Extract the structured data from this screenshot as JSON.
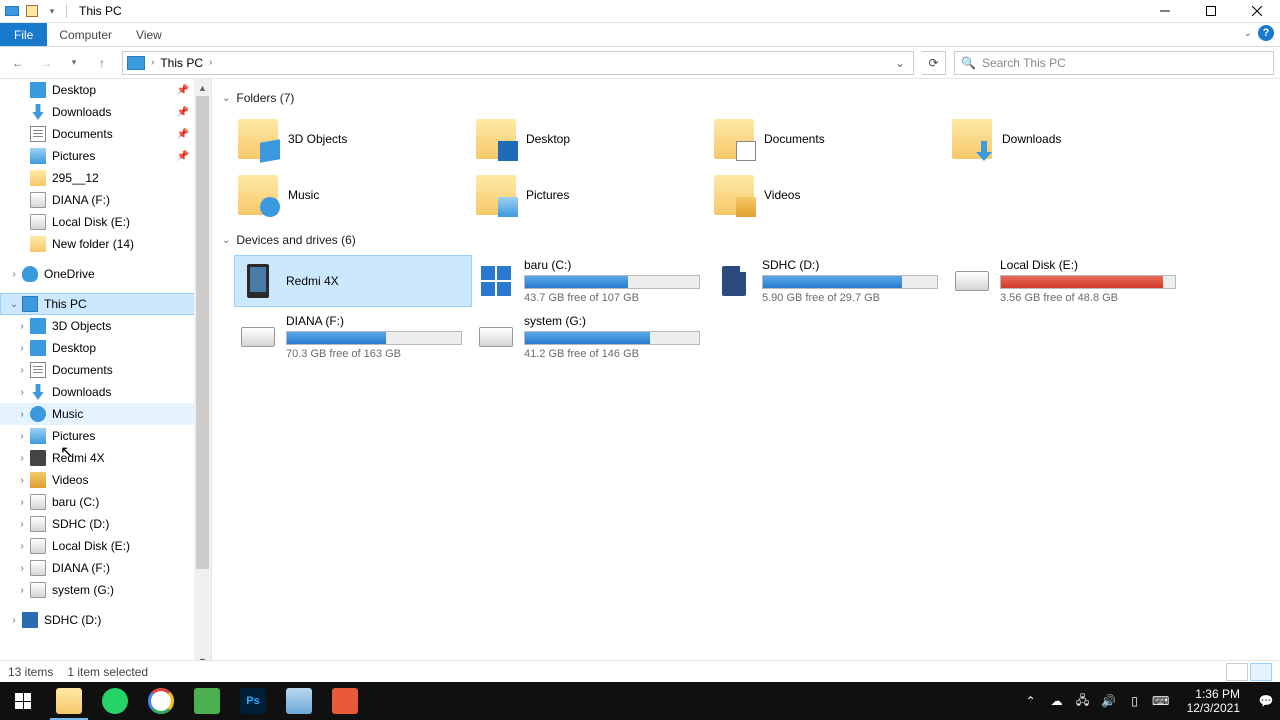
{
  "window": {
    "title": "This PC"
  },
  "ribbon": {
    "file": "File",
    "tabs": [
      "Computer",
      "View"
    ]
  },
  "address": {
    "crumbs": [
      "This PC"
    ]
  },
  "search": {
    "placeholder": "Search This PC"
  },
  "sidebar": {
    "quick": [
      {
        "label": "Desktop",
        "icon": "desktop",
        "pinned": true
      },
      {
        "label": "Downloads",
        "icon": "downloads",
        "pinned": true
      },
      {
        "label": "Documents",
        "icon": "docs",
        "pinned": true
      },
      {
        "label": "Pictures",
        "icon": "pics",
        "pinned": true
      },
      {
        "label": "295__12",
        "icon": "folder"
      },
      {
        "label": "DIANA (F:)",
        "icon": "drive"
      },
      {
        "label": "Local Disk (E:)",
        "icon": "drive"
      },
      {
        "label": "New folder (14)",
        "icon": "folder"
      }
    ],
    "onedrive": {
      "label": "OneDrive"
    },
    "thispc": {
      "label": "This PC",
      "children": [
        {
          "label": "3D Objects",
          "icon": "desktop"
        },
        {
          "label": "Desktop",
          "icon": "desktop"
        },
        {
          "label": "Documents",
          "icon": "docs"
        },
        {
          "label": "Downloads",
          "icon": "downloads"
        },
        {
          "label": "Music",
          "icon": "music",
          "hover": true
        },
        {
          "label": "Pictures",
          "icon": "pics"
        },
        {
          "label": "Redmi 4X",
          "icon": "phone"
        },
        {
          "label": "Videos",
          "icon": "video"
        },
        {
          "label": "baru (C:)",
          "icon": "drive"
        },
        {
          "label": "SDHC (D:)",
          "icon": "drive"
        },
        {
          "label": "Local Disk (E:)",
          "icon": "drive"
        },
        {
          "label": "DIANA (F:)",
          "icon": "drive"
        },
        {
          "label": "system (G:)",
          "icon": "drive"
        }
      ]
    },
    "sdhc": {
      "label": "SDHC (D:)"
    }
  },
  "groups": {
    "folders": {
      "title": "Folders (7)"
    },
    "drives": {
      "title": "Devices and drives (6)"
    }
  },
  "folders": [
    {
      "name": "3D Objects",
      "ov": "3d"
    },
    {
      "name": "Desktop",
      "ov": "desk"
    },
    {
      "name": "Documents",
      "ov": "doc"
    },
    {
      "name": "Downloads",
      "ov": "dl"
    },
    {
      "name": "Music",
      "ov": "music"
    },
    {
      "name": "Pictures",
      "ov": "pic"
    },
    {
      "name": "Videos",
      "ov": "vid"
    }
  ],
  "drives": [
    {
      "name": "Redmi 4X",
      "type": "phone",
      "selected": true
    },
    {
      "name": "baru (C:)",
      "type": "win",
      "free": "43.7 GB free of 107 GB",
      "pct": 59
    },
    {
      "name": "SDHC (D:)",
      "type": "sd",
      "free": "5.90 GB free of 29.7 GB",
      "pct": 80
    },
    {
      "name": "Local Disk (E:)",
      "type": "hdd",
      "free": "3.56 GB free of 48.8 GB",
      "pct": 93,
      "red": true
    },
    {
      "name": "DIANA (F:)",
      "type": "hdd",
      "free": "70.3 GB free of 163 GB",
      "pct": 57
    },
    {
      "name": "system (G:)",
      "type": "hdd",
      "free": "41.2 GB free of 146 GB",
      "pct": 72
    }
  ],
  "status": {
    "items": "13 items",
    "selected": "1 item selected"
  },
  "taskbar": {
    "time": "1:36 PM",
    "date": "12/3/2021"
  }
}
